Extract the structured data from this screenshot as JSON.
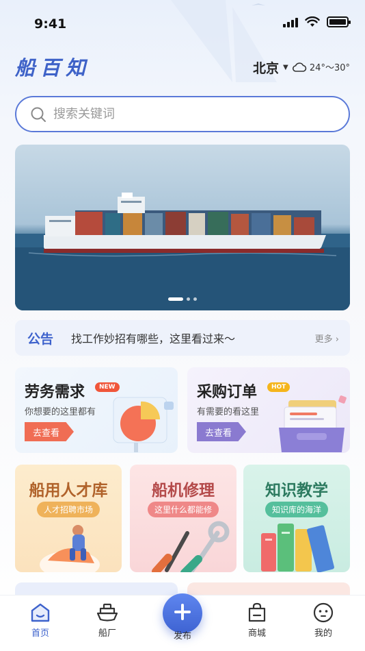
{
  "status": {
    "time": "9:41"
  },
  "header": {
    "logo": "船百知",
    "city": "北京",
    "temperature": "24°～30°"
  },
  "search": {
    "placeholder": "搜索关键词"
  },
  "banner": {
    "slides": 3,
    "active_slide": 1
  },
  "notice": {
    "title": "公告",
    "text": "找工作妙招有哪些，这里看过来～",
    "more": "更多"
  },
  "feature_cards": [
    {
      "title": "劳务需求",
      "tag": "NEW",
      "subtitle": "你想要的这里都有",
      "button": "去查看"
    },
    {
      "title": "采购订单",
      "tag": "HOT",
      "subtitle": "有需要的看这里",
      "button": "去查看"
    }
  ],
  "service_cards": [
    {
      "title": "船用人才库",
      "pill": "人才招聘市场"
    },
    {
      "title": "船机修理",
      "pill": "这里什么都能修"
    },
    {
      "title": "知识教学",
      "pill": "知识库的海洋"
    }
  ],
  "tabbar": {
    "items": [
      {
        "label": "首页"
      },
      {
        "label": "船厂"
      },
      {
        "label": "发布"
      },
      {
        "label": "商城"
      },
      {
        "label": "我的"
      }
    ],
    "active": "首页"
  },
  "colors": {
    "accent": "#3d62cc",
    "tag_new": "#f0563a",
    "tag_hot": "#f5b51c"
  }
}
